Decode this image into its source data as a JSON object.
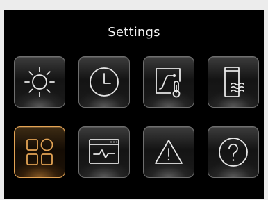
{
  "header": {
    "title": "Settings"
  },
  "colors": {
    "background": "#000000",
    "tile_border": "#6e6e6e",
    "icon_stroke": "#e6e6e6",
    "selected_accent": "#e3a354"
  },
  "tiles": [
    {
      "icon": "sun-icon",
      "selected": false
    },
    {
      "icon": "clock-icon",
      "selected": false
    },
    {
      "icon": "temperature-curve-icon",
      "selected": false
    },
    {
      "icon": "water-tank-icon",
      "selected": false
    },
    {
      "icon": "grid-apps-icon",
      "selected": true
    },
    {
      "icon": "monitor-graph-icon",
      "selected": false
    },
    {
      "icon": "warning-icon",
      "selected": false
    },
    {
      "icon": "help-icon",
      "selected": false
    }
  ]
}
